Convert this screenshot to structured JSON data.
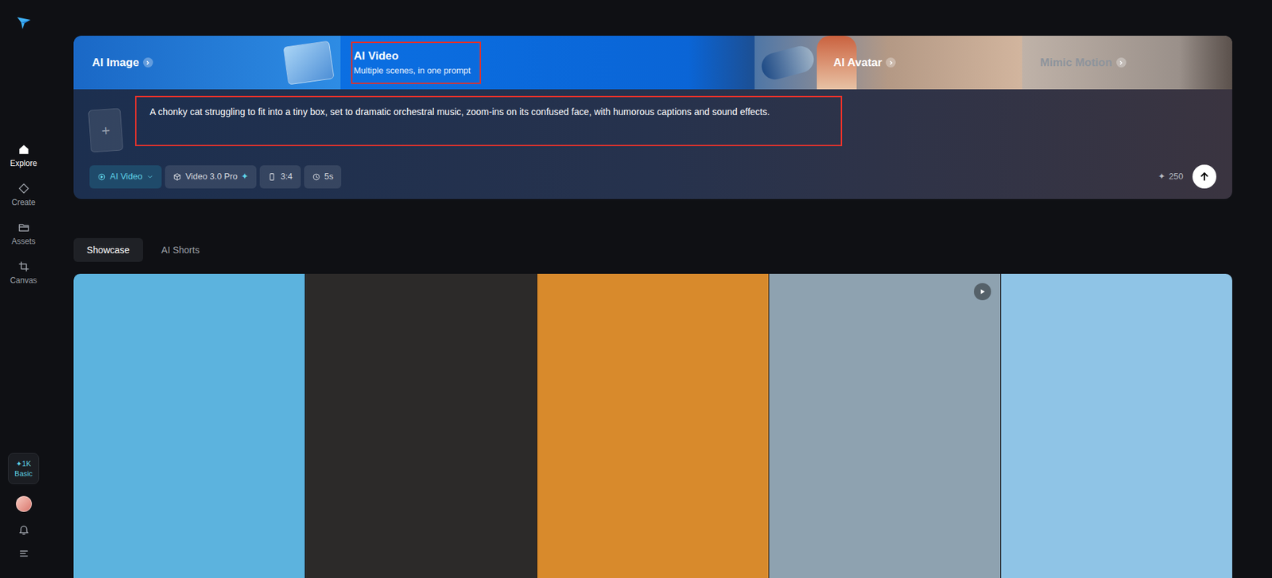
{
  "sidebar": {
    "items": [
      {
        "label": "Explore",
        "selected": true,
        "kind": "home"
      },
      {
        "label": "Create",
        "selected": false,
        "kind": "diamond"
      },
      {
        "label": "Assets",
        "selected": false,
        "kind": "folder"
      },
      {
        "label": "Canvas",
        "selected": false,
        "kind": "canvas"
      }
    ],
    "credits": "✦1K",
    "plan": "Basic"
  },
  "banner": {
    "tabs": [
      {
        "title": "AI Image",
        "subtitle": "",
        "selected": false,
        "highlighted": false
      },
      {
        "title": "AI Video",
        "subtitle": "Multiple scenes, in one prompt",
        "selected": true,
        "highlighted": true
      },
      {
        "title": "AI Avatar",
        "subtitle": "",
        "selected": false,
        "highlighted": false
      },
      {
        "title": "Mimic Motion",
        "subtitle": "",
        "selected": false,
        "highlighted": false
      }
    ]
  },
  "prompt": {
    "upload": "+",
    "text": "A chonky cat struggling to fit into a tiny box, set to dramatic orchestral music, zoom-ins on its confused face, with humorous captions and sound effects.",
    "highlighted": true,
    "chips": [
      {
        "label": "AI Video",
        "badge": "",
        "selected": true,
        "kind": "mode"
      },
      {
        "label": "Video 3.0 Pro",
        "badge": "✦",
        "selected": false,
        "kind": "model"
      },
      {
        "label": "3:4",
        "badge": "",
        "selected": false,
        "kind": "ratio"
      },
      {
        "label": "5s",
        "badge": "",
        "selected": false,
        "kind": "duration"
      }
    ],
    "credits_icon": "✦",
    "credits": "250"
  },
  "gallery_tabs": [
    {
      "label": "Showcase",
      "selected": true
    },
    {
      "label": "AI Shorts",
      "selected": false
    }
  ],
  "gallery": [
    {
      "color": "#5cb3de",
      "video": false
    },
    {
      "color": "#2c2a29",
      "video": false
    },
    {
      "color": "#d88a2c",
      "video": false
    },
    {
      "color": "#8ea2b0",
      "video": true
    },
    {
      "color": "#8fc4e6",
      "video": false
    }
  ]
}
